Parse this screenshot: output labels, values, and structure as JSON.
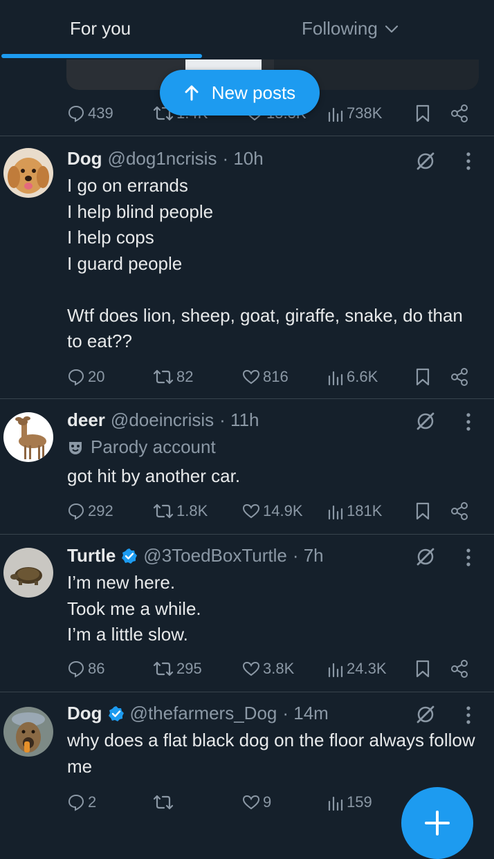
{
  "tabs": {
    "for_you": "For you",
    "following": "Following"
  },
  "new_posts_label": "New posts",
  "prev_post": {
    "replies": "439",
    "reposts": "1.4K",
    "likes": "15.3K",
    "views": "738K"
  },
  "posts": [
    {
      "name": "Dog",
      "handle": "@dog1ncrisis",
      "time": "· 10h",
      "verified": false,
      "text": "I go on errands\nI help blind people\nI help cops\nI guard people\n\nWtf does lion, sheep, goat, giraffe, snake, do than to eat??",
      "replies": "20",
      "reposts": "82",
      "likes": "816",
      "views": "6.6K"
    },
    {
      "name": "deer",
      "handle": "@doeincrisis",
      "time": "· 11h",
      "verified": false,
      "label": "Parody account",
      "text": "got hit by another car.",
      "replies": "292",
      "reposts": "1.8K",
      "likes": "14.9K",
      "views": "181K"
    },
    {
      "name": "Turtle",
      "handle": "@3ToedBoxTurtle",
      "time": "· 7h",
      "verified": true,
      "text": "I’m new here.\nTook me a while.\nI’m a little slow.",
      "replies": "86",
      "reposts": "295",
      "likes": "3.8K",
      "views": "24.3K"
    },
    {
      "name": "Dog",
      "handle": "@thefarmers_Dog",
      "time": "· 14m",
      "verified": true,
      "text": "why does a flat black dog on the floor always follow me",
      "replies": "2",
      "reposts": "",
      "likes": "9",
      "views": "159"
    }
  ],
  "colors": {
    "background": "#15202b",
    "accent": "#1d9bf0",
    "muted": "#8b98a5",
    "text": "#e7e9ea",
    "divider": "#38444d"
  }
}
